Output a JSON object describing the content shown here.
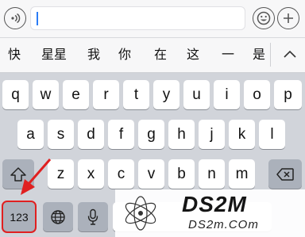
{
  "input_bar": {
    "text_value": "",
    "voice_icon": "voice-wave-icon",
    "emoji_icon": "emoji-icon",
    "plus_icon": "plus-icon"
  },
  "candidates": {
    "items": [
      "快",
      "星星",
      "我",
      "你",
      "在",
      "这",
      "一",
      "是"
    ],
    "collapse_icon": "chevron-up-icon"
  },
  "keyboard": {
    "row1": [
      "q",
      "w",
      "e",
      "r",
      "t",
      "y",
      "u",
      "i",
      "o",
      "p"
    ],
    "row2": [
      "a",
      "s",
      "d",
      "f",
      "g",
      "h",
      "j",
      "k",
      "l"
    ],
    "row3": [
      "z",
      "x",
      "c",
      "v",
      "b",
      "n",
      "m"
    ],
    "shift_icon": "shift-icon",
    "delete_icon": "delete-icon",
    "numbers_label": "123",
    "globe_icon": "globe-icon",
    "mic_icon": "microphone-icon"
  },
  "highlight_color": "#e02020",
  "watermark": {
    "title": "DS2M",
    "url": "DS2m.COm"
  }
}
